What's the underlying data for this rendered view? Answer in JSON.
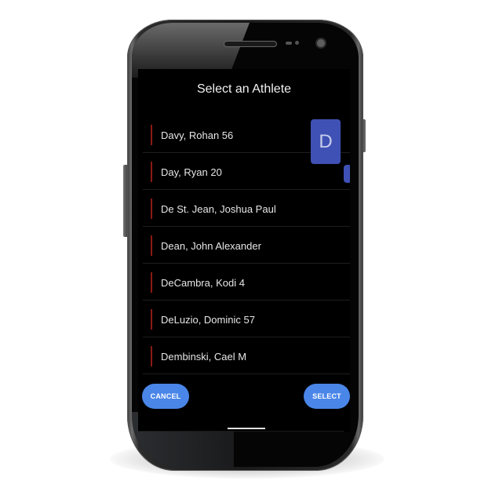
{
  "dialog": {
    "title": "Select an Athlete"
  },
  "athletes": [
    {
      "label": "Davy, Rohan 56"
    },
    {
      "label": "Day, Ryan 20"
    },
    {
      "label": "De St. Jean, Joshua Paul"
    },
    {
      "label": "Dean, John Alexander"
    },
    {
      "label": "DeCambra, Kodi 4"
    },
    {
      "label": "DeLuzio, Dominic 57"
    },
    {
      "label": "Dembinski, Cael M"
    }
  ],
  "fast_scroll": {
    "index_letter": "D"
  },
  "buttons": {
    "cancel_label": "CANCEL",
    "select_label": "SELECT"
  },
  "colors": {
    "accent": "#4a86e8",
    "index_bubble": "#3f51b5",
    "row_marker": "#8a1a14",
    "background": "#000000"
  }
}
